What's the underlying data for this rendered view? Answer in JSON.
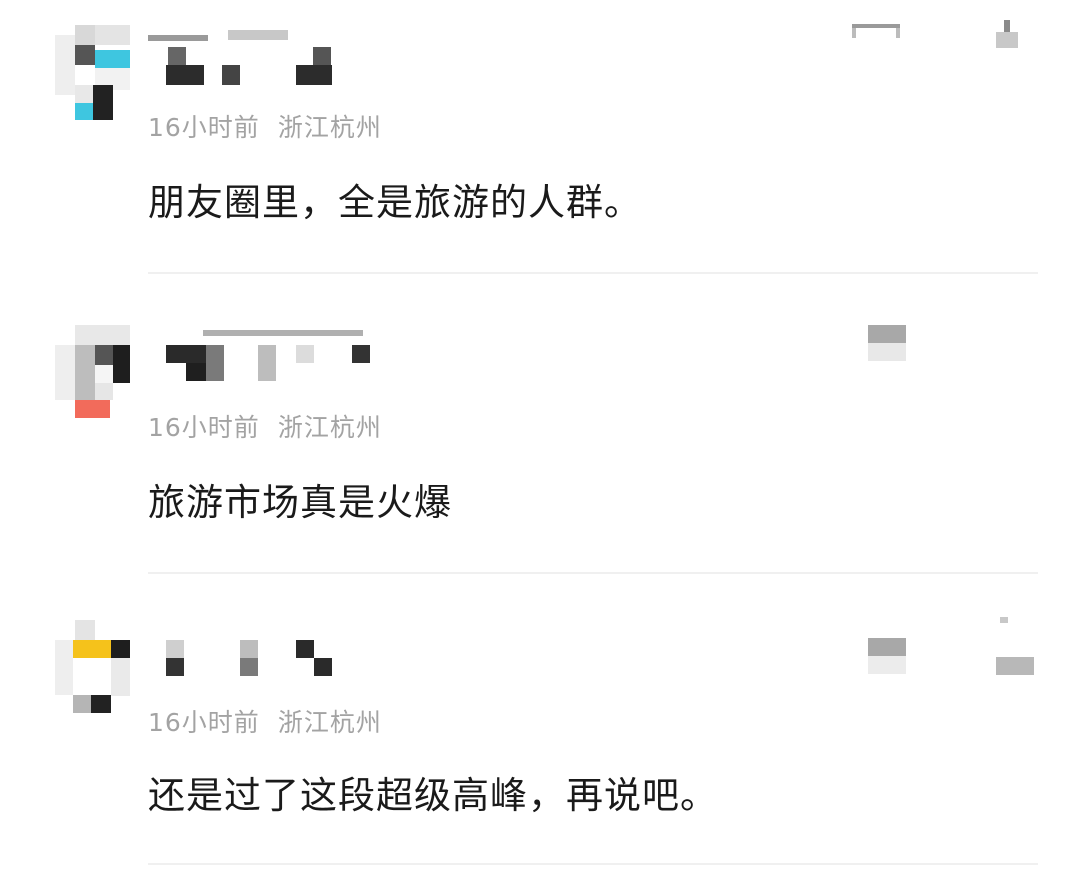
{
  "comments": [
    {
      "username": "",
      "time": "16小时前",
      "location": "浙江杭州",
      "text": "朋友圈里，全是旅游的人群。",
      "avatar_icon": "pixelated-avatar-icon",
      "accent_color": "#3ec6e0"
    },
    {
      "username": "",
      "time": "16小时前",
      "location": "浙江杭州",
      "text": "旅游市场真是火爆",
      "avatar_icon": "pixelated-avatar-icon",
      "accent_color": "#f26b5b"
    },
    {
      "username": "",
      "time": "16小时前",
      "location": "浙江杭州",
      "text": "还是过了这段超级高峰，再说吧。",
      "avatar_icon": "pixelated-avatar-icon",
      "accent_color": "#f5c21b"
    }
  ],
  "icons": {
    "reply": "reply-icon",
    "like": "like-icon"
  },
  "colors": {
    "text": "#1a1a1a",
    "meta": "#a3a3a3",
    "divider": "#f0f0f0"
  }
}
